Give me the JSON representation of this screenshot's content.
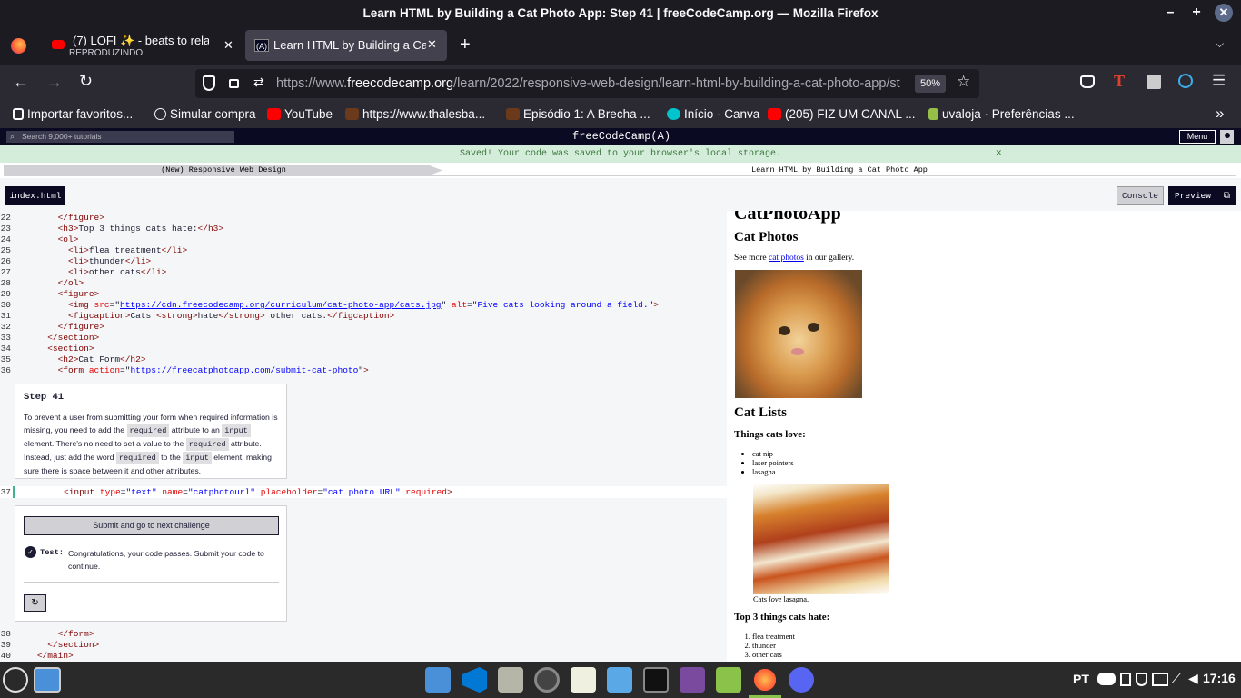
{
  "window": {
    "title": "Learn HTML by Building a Cat Photo App: Step 41 | freeCodeCamp.org — Mozilla Firefox"
  },
  "tabs": [
    {
      "title": "(7) LOFI ✨ - beats to relax -",
      "subtitle": "REPRODUZINDO"
    },
    {
      "title": "Learn HTML by Building a Ca"
    }
  ],
  "url": {
    "prefix": "https://www.",
    "domain": "freecodecamp.org",
    "path": "/learn/2022/responsive-web-design/learn-html-by-building-a-cat-photo-app/st",
    "zoom": "50%"
  },
  "bookmarks": [
    "Importar favoritos...",
    "Simular compra",
    "YouTube",
    "https://www.thalesba...",
    "Episódio 1: A Brecha ...",
    "Início - Canva",
    "(205) FIZ UM CANAL ...",
    "uvaloja · Preferências ..."
  ],
  "fcc": {
    "search_placeholder": "Search 9,000+ tutorials",
    "logo": "freeCodeCamp(",
    "logo_icon": "A",
    "logo_end": ")",
    "menu": "Menu"
  },
  "saved_message": "Saved! Your code was saved to your browser's local storage.",
  "breadcrumb": {
    "left": "(New) Responsive Web Design",
    "right": "Learn HTML by Building a Cat Photo App"
  },
  "editor_tabs": {
    "file": "index.html",
    "console": "Console",
    "preview": "Preview"
  },
  "code_lines": [
    {
      "n": "22",
      "pad": "        ",
      "parts": [
        [
          "tg",
          "</figure>"
        ]
      ]
    },
    {
      "n": "23",
      "pad": "        ",
      "parts": [
        [
          "tg",
          "<h3>"
        ],
        [
          "",
          "Top 3 things cats hate:"
        ],
        [
          "tg",
          "</h3>"
        ]
      ]
    },
    {
      "n": "24",
      "pad": "        ",
      "parts": [
        [
          "tg",
          "<ol>"
        ]
      ]
    },
    {
      "n": "25",
      "pad": "          ",
      "parts": [
        [
          "tg",
          "<li>"
        ],
        [
          "",
          "flea treatment"
        ],
        [
          "tg",
          "</li>"
        ]
      ]
    },
    {
      "n": "26",
      "pad": "          ",
      "parts": [
        [
          "tg",
          "<li>"
        ],
        [
          "",
          "thunder"
        ],
        [
          "tg",
          "</li>"
        ]
      ]
    },
    {
      "n": "27",
      "pad": "          ",
      "parts": [
        [
          "tg",
          "<li>"
        ],
        [
          "",
          "other cats"
        ],
        [
          "tg",
          "</li>"
        ]
      ]
    },
    {
      "n": "28",
      "pad": "        ",
      "parts": [
        [
          "tg",
          "</ol>"
        ]
      ]
    },
    {
      "n": "29",
      "pad": "        ",
      "parts": [
        [
          "tg",
          "<figure>"
        ]
      ]
    },
    {
      "n": "30",
      "pad": "          ",
      "parts": [
        [
          "tg",
          "<img "
        ],
        [
          "at",
          "src"
        ],
        [
          "",
          "=\""
        ],
        [
          "ul",
          "https://cdn.freecodecamp.org/curriculum/cat-photo-app/cats.jpg"
        ],
        [
          "",
          "\" "
        ],
        [
          "at",
          "alt"
        ],
        [
          "",
          "="
        ],
        [
          "av",
          "\"Five cats looking around a field.\""
        ],
        [
          "tg",
          ">"
        ]
      ]
    },
    {
      "n": "31",
      "pad": "          ",
      "parts": [
        [
          "tg",
          "<figcaption>"
        ],
        [
          "",
          "Cats "
        ],
        [
          "tg",
          "<strong>"
        ],
        [
          "",
          "hate"
        ],
        [
          "tg",
          "</strong>"
        ],
        [
          "",
          " other cats."
        ],
        [
          "tg",
          "</figcaption>"
        ]
      ]
    },
    {
      "n": "32",
      "pad": "        ",
      "parts": [
        [
          "tg",
          "</figure>"
        ]
      ]
    },
    {
      "n": "33",
      "pad": "      ",
      "parts": [
        [
          "tg",
          "</section>"
        ]
      ]
    },
    {
      "n": "34",
      "pad": "      ",
      "parts": [
        [
          "tg",
          "<section>"
        ]
      ]
    },
    {
      "n": "35",
      "pad": "        ",
      "parts": [
        [
          "tg",
          "<h2>"
        ],
        [
          "",
          "Cat Form"
        ],
        [
          "tg",
          "</h2>"
        ]
      ]
    },
    {
      "n": "36",
      "pad": "        ",
      "parts": [
        [
          "tg",
          "<form "
        ],
        [
          "at",
          "action"
        ],
        [
          "",
          "=\""
        ],
        [
          "ul",
          "https://freecatphotoapp.com/submit-cat-photo"
        ],
        [
          "",
          "\""
        ],
        [
          "tg",
          ">"
        ]
      ]
    }
  ],
  "step": {
    "title": "Step 41",
    "p1": "To prevent a user from submitting your form when required information is missing, you need to add the ",
    "kw1": "required",
    "p2": " attribute to an ",
    "kw2": "input",
    "p3": " element. There's no need to set a value to the ",
    "kw3": "required",
    "p4": " attribute. Instead, just add the word ",
    "kw4": "required",
    "p5": " to the ",
    "kw5": "input",
    "p6": " element, making sure there is space between it and other attributes."
  },
  "line37": {
    "n": "37",
    "parts": [
      [
        "tg",
        "<input "
      ],
      [
        "at",
        "type"
      ],
      [
        "",
        "="
      ],
      [
        "av",
        "\"text\""
      ],
      [
        "",
        " "
      ],
      [
        "at",
        "name"
      ],
      [
        "",
        "="
      ],
      [
        "av",
        "\"catphotourl\""
      ],
      [
        "",
        " "
      ],
      [
        "at",
        "placeholder"
      ],
      [
        "",
        "="
      ],
      [
        "av",
        "\"cat photo URL\""
      ],
      [
        "",
        " "
      ],
      [
        "at",
        "required"
      ],
      [
        "tg",
        ">"
      ]
    ]
  },
  "submit": {
    "button": "Submit and go to next challenge",
    "test_label": "Test:",
    "test_text": "Congratulations, your code passes. Submit your code to continue.",
    "reset_icon": "↻"
  },
  "code_lines_end": [
    {
      "n": "38",
      "pad": "        ",
      "parts": [
        [
          "tg",
          "</form>"
        ]
      ]
    },
    {
      "n": "39",
      "pad": "      ",
      "parts": [
        [
          "tg",
          "</section>"
        ]
      ]
    },
    {
      "n": "40",
      "pad": "    ",
      "parts": [
        [
          "tg",
          "</main>"
        ]
      ]
    }
  ],
  "preview": {
    "h1": "CatPhotoApp",
    "h2a": "Cat Photos",
    "see_more_pre": "See more ",
    "see_more_link": "cat photos",
    "see_more_post": " in our gallery.",
    "h2b": "Cat Lists",
    "h3a": "Things cats love:",
    "love": [
      "cat nip",
      "laser pointers",
      "lasagna"
    ],
    "caption_pre": "Cats ",
    "caption_em": "love",
    "caption_post": " lasagna.",
    "h3b": "Top 3 things cats hate:",
    "hate": [
      "flea treatment",
      "thunder",
      "other cats"
    ]
  },
  "taskbar": {
    "lang": "PT",
    "time": "17:16"
  },
  "colors": {
    "fcc_dark": "#0a0a23",
    "saved_bg": "#d4edda",
    "firefox_dark": "#1c1b22"
  }
}
